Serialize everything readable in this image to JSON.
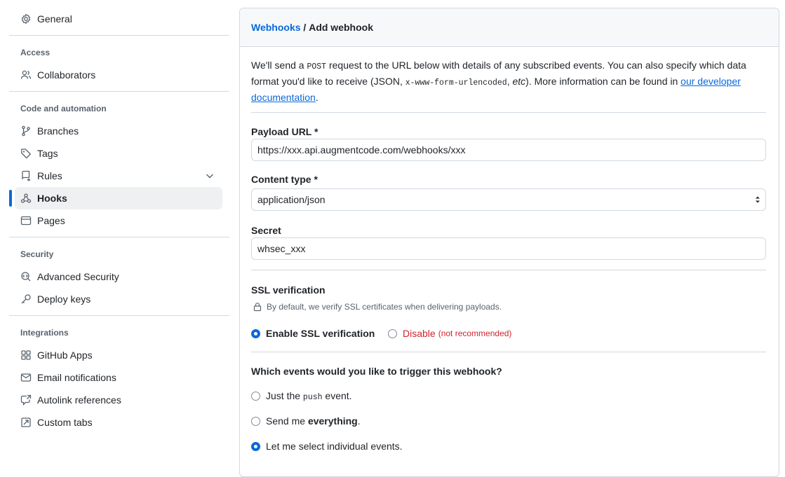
{
  "sidebar": {
    "general": "General",
    "access_heading": "Access",
    "collaborators": "Collaborators",
    "code_heading": "Code and automation",
    "branches": "Branches",
    "tags": "Tags",
    "rules": "Rules",
    "hooks": "Hooks",
    "pages": "Pages",
    "security_heading": "Security",
    "advanced_security": "Advanced Security",
    "deploy_keys": "Deploy keys",
    "integrations_heading": "Integrations",
    "github_apps": "GitHub Apps",
    "email_notifications": "Email notifications",
    "autolink_references": "Autolink references",
    "custom_tabs": "Custom tabs"
  },
  "header": {
    "crumb_link": "Webhooks",
    "separator": " / ",
    "title": "Add webhook"
  },
  "intro": {
    "p1": "We'll send a ",
    "post": "POST",
    "p2": " request to the URL below with details of any subscribed events. You can also specify which data format you'd like to receive (JSON, ",
    "form": "x-www-form-urlencoded",
    "p3": ", ",
    "etc": "etc",
    "p4": "). More information can be found in ",
    "link": "our developer documentation",
    "p5": "."
  },
  "form": {
    "payload_label": "Payload URL *",
    "payload_value": "https://xxx.api.augmentcode.com/webhooks/xxx",
    "content_type_label": "Content type *",
    "content_type_value": "application/json",
    "secret_label": "Secret",
    "secret_value": "whsec_xxx",
    "ssl_label": "SSL verification",
    "ssl_hint": "By default, we verify SSL certificates when delivering payloads.",
    "ssl_enable": "Enable SSL verification",
    "ssl_disable": "Disable",
    "ssl_disable_note": "(not recommended)",
    "events_label": "Which events would you like to trigger this webhook?",
    "event_push_pre": "Just the ",
    "event_push_code": "push",
    "event_push_post": " event.",
    "event_all_pre": "Send me ",
    "event_all_bold": "everything",
    "event_all_post": ".",
    "event_select": "Let me select individual events."
  },
  "icons": {
    "general": "gear-icon",
    "collaborators": "people-icon",
    "branches": "git-branch-icon",
    "tags": "tag-icon",
    "rules": "repo-push-icon",
    "hooks": "webhook-icon",
    "pages": "browser-icon",
    "advanced_security": "codescan-icon",
    "deploy_keys": "key-icon",
    "github_apps": "apps-icon",
    "email_notifications": "mail-icon",
    "autolink_references": "cross-reference-icon",
    "custom_tabs": "note-icon",
    "lock": "lock-icon"
  },
  "colors": {
    "accent": "#0969da",
    "danger": "#d1242f",
    "border": "#d1d9e0",
    "muted": "#59636e"
  }
}
